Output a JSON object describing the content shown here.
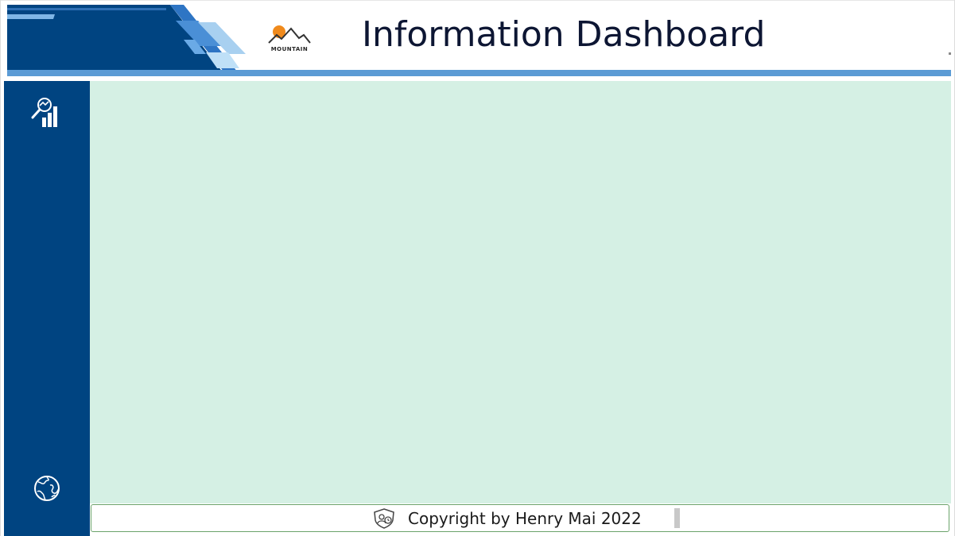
{
  "header": {
    "title": "Information Dashboard",
    "logo_text": "MOUNTAIN"
  },
  "sidebar": {
    "items": [
      {
        "icon": "analytics-chart-icon"
      },
      {
        "icon": "globe-icon"
      }
    ]
  },
  "footer": {
    "copyright": "Copyright by Henry Mai 2022",
    "icon": "shield-user-icon"
  },
  "colors": {
    "sidebar": "#004481",
    "main_background": "#d5f0e4",
    "accent_light_blue": "#5b9bd5",
    "logo_sun": "#f08a1c",
    "title_text": "#0d1633"
  }
}
